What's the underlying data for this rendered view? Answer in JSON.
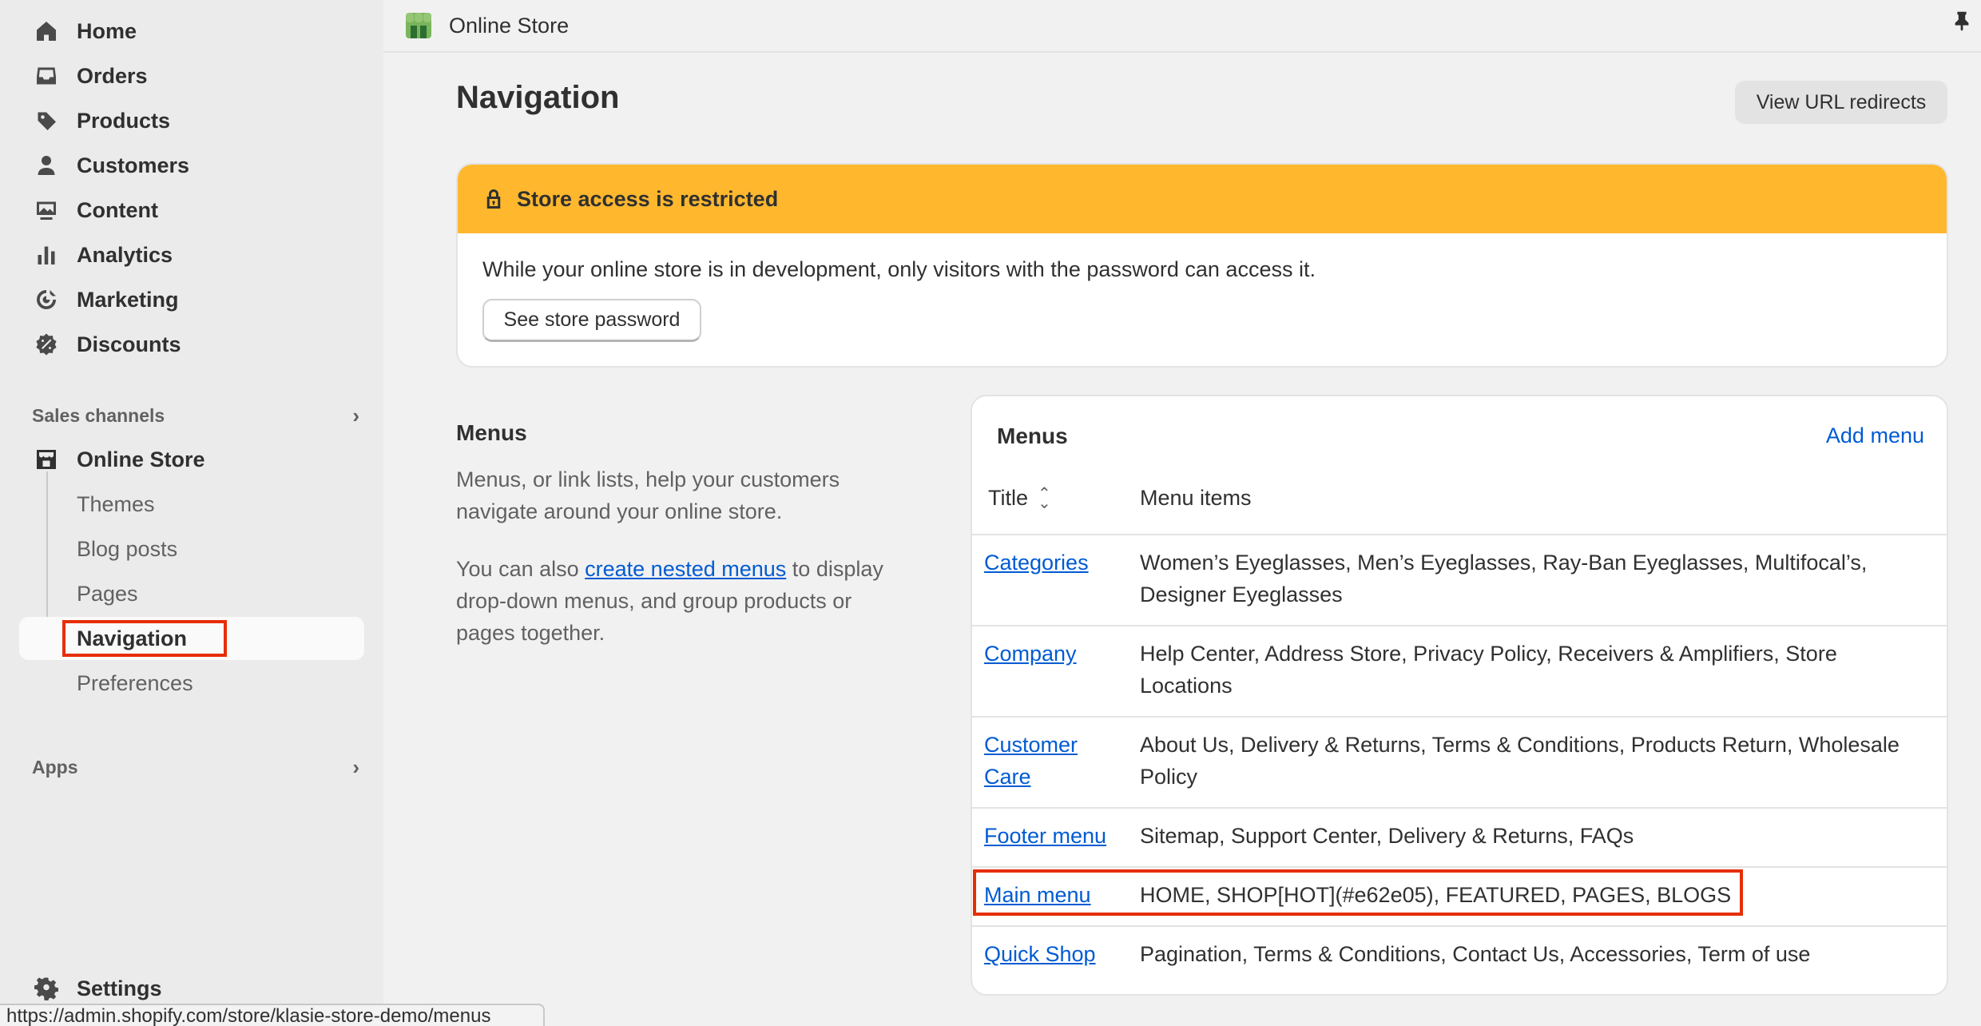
{
  "sidebar": {
    "items": [
      {
        "label": "Home",
        "icon": "home-icon"
      },
      {
        "label": "Orders",
        "icon": "inbox-icon"
      },
      {
        "label": "Products",
        "icon": "tag-icon"
      },
      {
        "label": "Customers",
        "icon": "person-icon"
      },
      {
        "label": "Content",
        "icon": "image-icon"
      },
      {
        "label": "Analytics",
        "icon": "bar-chart-icon"
      },
      {
        "label": "Marketing",
        "icon": "target-icon"
      },
      {
        "label": "Discounts",
        "icon": "discount-icon"
      }
    ],
    "sales_channels_label": "Sales channels",
    "online_store_label": "Online Store",
    "sub_items": [
      "Themes",
      "Blog posts",
      "Pages",
      "Navigation",
      "Preferences"
    ],
    "apps_label": "Apps",
    "settings_label": "Settings"
  },
  "topbar": {
    "title": "Online Store"
  },
  "main": {
    "page_title": "Navigation",
    "view_redirects_label": "View URL redirects",
    "banner": {
      "title": "Store access is restricted",
      "text": "While your online store is in development, only visitors with the password can access it.",
      "button_label": "See store password"
    },
    "menus_section": {
      "label": "Menus",
      "desc1": "Menus, or link lists, help your customers navigate around your online store.",
      "desc2_before": "You can also ",
      "desc2_link": "create nested menus",
      "desc2_after": " to display drop-down menus, and group products or pages together."
    },
    "card": {
      "title": "Menus",
      "add_label": "Add menu",
      "col_title": "Title",
      "col_items": "Menu items",
      "rows": [
        {
          "title": "Categories",
          "items": "Women’s Eyeglasses, Men’s Eyeglasses, Ray-Ban Eyeglasses, Multifocal’s, Designer Eyeglasses"
        },
        {
          "title": "Company",
          "items": "Help Center, Address Store, Privacy Policy, Receivers & Amplifiers, Store Locations"
        },
        {
          "title": "Customer Care",
          "items": "About Us, Delivery & Returns, Terms & Conditions, Products Return, Wholesale Policy"
        },
        {
          "title": "Footer menu",
          "items": "Sitemap, Support Center, Delivery & Returns, FAQs"
        },
        {
          "title": "Main menu",
          "items": "HOME, SHOP[HOT](#e62e05), FEATURED, PAGES, BLOGS"
        },
        {
          "title": "Quick Shop",
          "items": "Pagination, Terms & Conditions, Contact Us, Accessories, Term of use"
        }
      ]
    }
  },
  "status_url": "https://admin.shopify.com/store/klasie-store-demo/menus",
  "colors": {
    "accent_link": "#005bd3",
    "banner_warning": "#ffb82e",
    "highlight": "#e62e05"
  }
}
